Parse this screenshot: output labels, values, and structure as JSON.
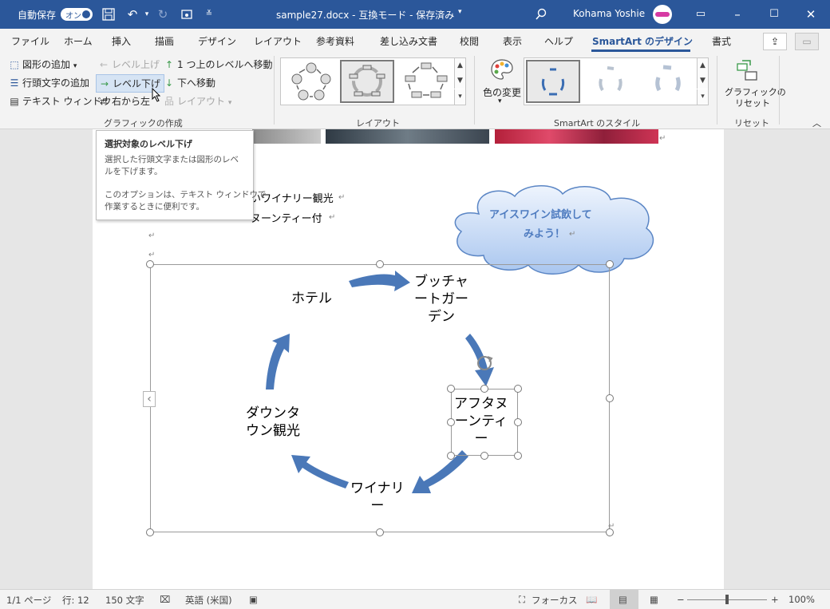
{
  "titlebar": {
    "autosave_label": "自動保存",
    "autosave_state": "オン",
    "doc_title": "sample27.docx - 互換モード - 保存済み",
    "user_name": "Kohama Yoshie",
    "icons": [
      "save-icon",
      "undo-icon",
      "redo-icon",
      "touch-mode-icon",
      "customize-icon",
      "search-icon",
      "ribbon-display-icon",
      "minimize-icon",
      "maximize-icon",
      "close-icon"
    ]
  },
  "tabs": [
    {
      "label": "ファイル"
    },
    {
      "label": "ホーム"
    },
    {
      "label": "挿入"
    },
    {
      "label": "描画"
    },
    {
      "label": "デザイン"
    },
    {
      "label": "レイアウト"
    },
    {
      "label": "参考資料"
    },
    {
      "label": "差し込み文書"
    },
    {
      "label": "校閲"
    },
    {
      "label": "表示"
    },
    {
      "label": "ヘルプ"
    },
    {
      "label": "SmartArt のデザイン"
    },
    {
      "label": "書式"
    }
  ],
  "active_tab": "SmartArt のデザイン",
  "ribbon": {
    "create_graphic": {
      "add_shape": "図形の追加",
      "add_bullet": "行頭文字の追加",
      "text_pane": "テキスト ウィンドウ",
      "promote": "レベル上げ",
      "demote": "レベル下げ",
      "right_to_left": "右から左",
      "move_up": "1 つ上のレベルへ移動",
      "move_down": "下へ移動",
      "layout": "レイアウト",
      "group_label": "グラフィックの作成"
    },
    "layouts": {
      "group_label": "レイアウト"
    },
    "styles": {
      "change_colors": "色の変更",
      "group_label": "SmartArt のスタイル"
    },
    "reset": {
      "reset_graphic_line1": "グラフィックの",
      "reset_graphic_line2": "リセット",
      "group_label": "リセット"
    }
  },
  "tooltip": {
    "title": "選択対象のレベル下げ",
    "line1": "選択した行頭文字または図形のレベ",
    "line2": "ルを下げます。",
    "line3": "このオプションは、テキスト ウィンドウで",
    "line4": "作業するときに便利です。"
  },
  "document": {
    "line1": "いワイナリー観光",
    "line2": "ヌーンティー付",
    "callout_line1": "アイスワイン試飲して",
    "callout_line2": "みよう！",
    "smartart_nodes": {
      "hotel": "ホテル",
      "butchart_1": "ブッチャ",
      "butchart_2": "ートガー",
      "butchart_3": "デン",
      "afternoon_1": "アフタヌ",
      "afternoon_2": "ーンティ",
      "afternoon_3": "ー",
      "winery_1": "ワイナリ",
      "winery_2": "ー",
      "downtown_1": "ダウンタ",
      "downtown_2": "ウン観光"
    },
    "text_pane_toggle": "‹"
  },
  "statusbar": {
    "page": "1/1 ページ",
    "line": "行: 12",
    "chars": "150 文字",
    "language": "英語 (米国)",
    "focus": "フォーカス",
    "zoom": "100%"
  },
  "colors": {
    "accent": "#2b579a",
    "arrow": "#4a78b8",
    "cloud_fill": "#c5d9f5"
  }
}
